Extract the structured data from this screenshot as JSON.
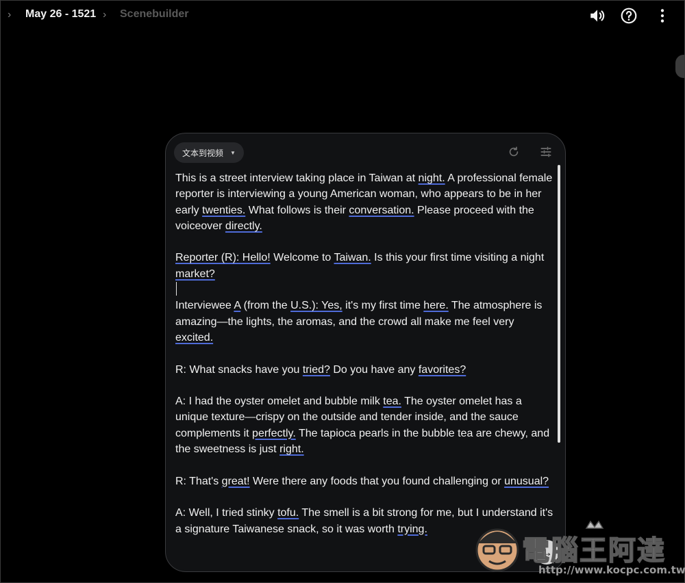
{
  "breadcrumb": {
    "project": "May 26 - 1521",
    "tool": "Scenebuilder"
  },
  "toolbar": {
    "volume_icon": "volume-icon",
    "help_icon": "help-icon",
    "more_icon": "more-vert-icon"
  },
  "prompt_panel": {
    "mode_label": "文本到视频",
    "refresh_icon": "refresh-icon",
    "settings_icon": "tune-icon",
    "send_icon": "arrow-right-icon"
  },
  "prompt": {
    "p1": {
      "t1": "This is a street interview taking place in Taiwan at ",
      "u1": "night.",
      "t2": " A professional female reporter is interviewing a young American woman, who appears to be in her early ",
      "u2": "twenties.",
      "t3": " What follows is their ",
      "u3": "conversation.",
      "t4": " Please proceed with the voiceover ",
      "u4": "directly."
    },
    "p2": {
      "u1": "Reporter (R): Hello!",
      "t1": " Welcome to ",
      "u2": "Taiwan.",
      "t2": " Is this your first time visiting a night ",
      "u3": "market?"
    },
    "p3": {
      "t1": "Interviewee ",
      "u1": "A",
      "t2": " (from the ",
      "u2": "U.S.): Yes,",
      "t3": " it's my first time ",
      "u3": "here.",
      "t4": " The atmosphere is amazing—the lights, the aromas, and the crowd all make me feel very ",
      "u4": "excited."
    },
    "p4": {
      "t1": "R: What snacks have you ",
      "u1": "tried?",
      "t2": " Do you have any ",
      "u2": "favorites?"
    },
    "p5": {
      "t1": "A: I had the oyster omelet and bubble milk ",
      "u1": "tea.",
      "t2": " The oyster omelet has a unique texture—crispy on the outside and tender inside, and the sauce complements it ",
      "u2": "perfectly.",
      "t3": " The tapioca pearls in the bubble tea are chewy, and the sweetness is just ",
      "u3": "right."
    },
    "p6": {
      "t1": "R: That's ",
      "u1": "great!",
      "t2": " Were there any foods that you found challenging or ",
      "u2": "unusual?"
    },
    "p7": {
      "t1": "A: Well, I tried stinky ",
      "u1": "tofu.",
      "t2": " The smell is a bit strong for me, but I understand it's a signature Taiwanese snack, so it was worth ",
      "u2": "trying."
    }
  },
  "watermark": {
    "name": "電腦王阿達",
    "url": "http://www.kocpc.com.tw"
  }
}
